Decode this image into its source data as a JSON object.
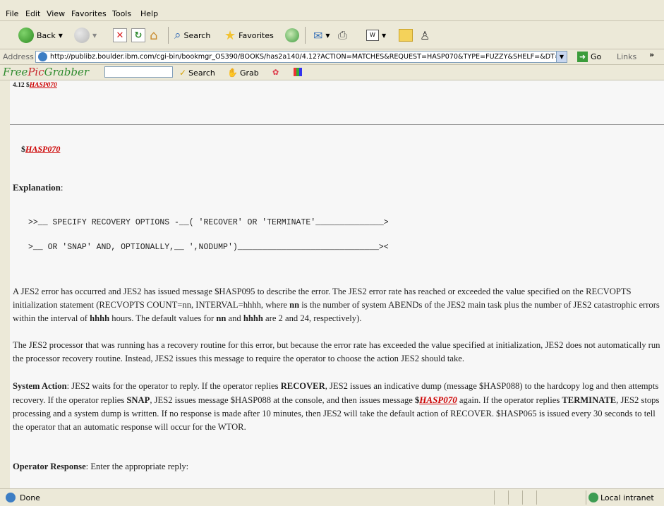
{
  "menu": {
    "items": [
      "File",
      "Edit",
      "View",
      "Favorites",
      "Tools",
      "Help"
    ]
  },
  "toolbar": {
    "back_label": "Back",
    "search_label": "Search",
    "favorites_label": "Favorites"
  },
  "address": {
    "label": "Address",
    "url": "http://publibz.boulder.ibm.com/cgi-bin/bookmgr_OS390/BOOKS/has2a140/4.12?ACTION=MATCHES&REQUEST=HASP070&TYPE=FUZZY&SHELF=&DT=",
    "go_label": "Go",
    "links_label": "Links"
  },
  "freepicgrabber": {
    "brand_free": "Free",
    "brand_pic": "Pic",
    "brand_grabber": "Grabber",
    "search_label": "Search",
    "grab_label": "Grab"
  },
  "document": {
    "section_prefix": "4.12 $",
    "section_link": "HASP070",
    "title_prefix": "$",
    "title_link": "HASP070",
    "explanation_heading": "Explanation",
    "syntax_line1": ">>__ SPECIFY RECOVERY OPTIONS -__( 'RECOVER' OR 'TERMINATE'______________>",
    "syntax_line2": ">__ OR 'SNAP' AND, OPTIONALLY,__ ',NODUMP')_____________________________><",
    "para1_a": "A JES2 error has occurred and JES2 has issued message $HASP095 to describe the error. The JES2 error rate has reached or exceeded the value specified on the RECVOPTS initialization statement (RECVOPTS COUNT=nn, INTERVAL=hhhh, where ",
    "para1_nn": "nn",
    "para1_b": " is the number of system ABENDs of the JES2 main task plus the number of JES2 catastrophic errors within the interval of ",
    "para1_hhhh": "hhhh",
    "para1_c": " hours. The default values for ",
    "para1_nn2": "nn",
    "para1_d": " and ",
    "para1_hhhh2": "hhhh",
    "para1_e": " are 2 and 24, respectively).",
    "para2": "The JES2 processor that was running has a recovery routine for this error, but because the error rate has exceeded the value specified at initialization, JES2 does not automatically run the processor recovery routine. Instead, JES2 issues this message to require the operator to choose the action JES2 should take.",
    "system_action_heading": "System Action",
    "sa_a": " JES2 waits for the operator to reply. If the operator replies ",
    "sa_recover": "RECOVER",
    "sa_b": ", JES2 issues an indicative dump (message $HASP088) to the hardcopy log and then attempts recovery. If the operator replies ",
    "sa_snap": "SNAP",
    "sa_c": ", JES2 issues message $HASP088 at the console, and then issues message ",
    "sa_dollar": "$",
    "sa_link": "HASP070",
    "sa_d": " again. If the operator replies ",
    "sa_terminate": "TERMINATE",
    "sa_e": ", JES2 stops processing and a system dump is written. If no response is made after 10 minutes, then JES2 will take the default action of RECOVER. $HASP065 is issued every 30 seconds to tell the operator that an automatic response will occur for the WTOR.",
    "operator_response_heading": "Operator Response",
    "or_text": " Enter the appropriate reply:"
  },
  "status": {
    "done": "Done",
    "zone": "Local intranet"
  }
}
